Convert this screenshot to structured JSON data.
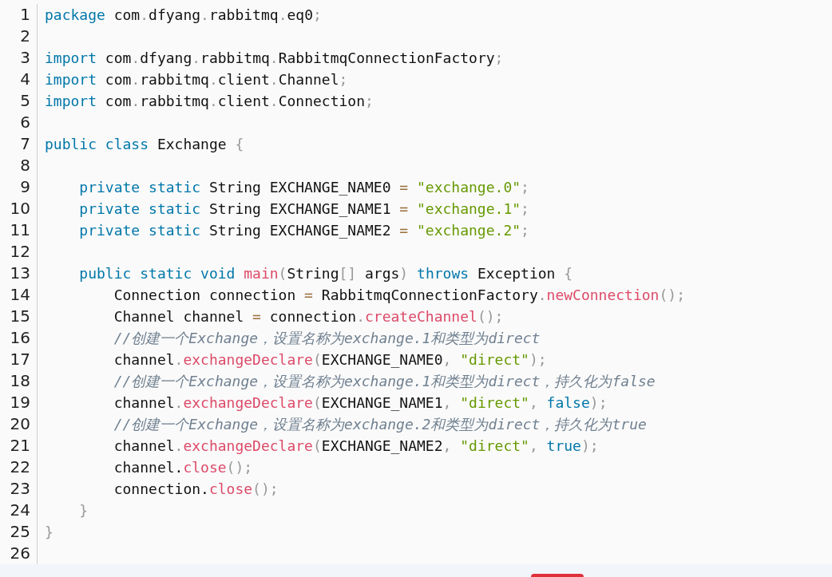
{
  "editor": {
    "lines": [
      {
        "number": "1",
        "tokens": [
          {
            "kind": "keyword",
            "text": "package"
          },
          {
            "kind": "plain",
            "text": " com"
          },
          {
            "kind": "punct",
            "text": "."
          },
          {
            "kind": "plain",
            "text": "dfyang"
          },
          {
            "kind": "punct",
            "text": "."
          },
          {
            "kind": "plain",
            "text": "rabbitmq"
          },
          {
            "kind": "punct",
            "text": "."
          },
          {
            "kind": "plain",
            "text": "eq0"
          },
          {
            "kind": "punct",
            "text": ";"
          }
        ]
      },
      {
        "number": "2"
      },
      {
        "number": "3",
        "tokens": [
          {
            "kind": "keyword",
            "text": "import"
          },
          {
            "kind": "plain",
            "text": " com"
          },
          {
            "kind": "punct",
            "text": "."
          },
          {
            "kind": "plain",
            "text": "dfyang"
          },
          {
            "kind": "punct",
            "text": "."
          },
          {
            "kind": "plain",
            "text": "rabbitmq"
          },
          {
            "kind": "punct",
            "text": "."
          },
          {
            "kind": "plain",
            "text": "RabbitmqConnectionFactory"
          },
          {
            "kind": "punct",
            "text": ";"
          }
        ]
      },
      {
        "number": "4",
        "tokens": [
          {
            "kind": "keyword",
            "text": "import"
          },
          {
            "kind": "plain",
            "text": " com"
          },
          {
            "kind": "punct",
            "text": "."
          },
          {
            "kind": "plain",
            "text": "rabbitmq"
          },
          {
            "kind": "punct",
            "text": "."
          },
          {
            "kind": "plain",
            "text": "client"
          },
          {
            "kind": "punct",
            "text": "."
          },
          {
            "kind": "plain",
            "text": "Channel"
          },
          {
            "kind": "punct",
            "text": ";"
          }
        ]
      },
      {
        "number": "5",
        "tokens": [
          {
            "kind": "keyword",
            "text": "import"
          },
          {
            "kind": "plain",
            "text": " com"
          },
          {
            "kind": "punct",
            "text": "."
          },
          {
            "kind": "plain",
            "text": "rabbitmq"
          },
          {
            "kind": "punct",
            "text": "."
          },
          {
            "kind": "plain",
            "text": "client"
          },
          {
            "kind": "punct",
            "text": "."
          },
          {
            "kind": "plain",
            "text": "Connection"
          },
          {
            "kind": "punct",
            "text": ";"
          }
        ]
      },
      {
        "number": "6"
      },
      {
        "number": "7",
        "tokens": [
          {
            "kind": "keyword",
            "text": "public class"
          },
          {
            "kind": "plain",
            "text": " Exchange "
          },
          {
            "kind": "punct",
            "text": "{"
          }
        ]
      },
      {
        "number": "8"
      },
      {
        "number": "9",
        "tokens": [
          {
            "kind": "keyword",
            "text": "    private static"
          },
          {
            "kind": "plain",
            "text": " String EXCHANGE_NAME0 "
          },
          {
            "kind": "operator",
            "text": "="
          },
          {
            "kind": "string",
            "text": " \"exchange.0\""
          },
          {
            "kind": "punct",
            "text": ";"
          }
        ]
      },
      {
        "number": "10",
        "tokens": [
          {
            "kind": "keyword",
            "text": "    private static"
          },
          {
            "kind": "plain",
            "text": " String EXCHANGE_NAME1 "
          },
          {
            "kind": "operator",
            "text": "="
          },
          {
            "kind": "string",
            "text": " \"exchange.1\""
          },
          {
            "kind": "punct",
            "text": ";"
          }
        ]
      },
      {
        "number": "11",
        "tokens": [
          {
            "kind": "keyword",
            "text": "    private static"
          },
          {
            "kind": "plain",
            "text": " String EXCHANGE_NAME2 "
          },
          {
            "kind": "operator",
            "text": "="
          },
          {
            "kind": "string",
            "text": " \"exchange.2\""
          },
          {
            "kind": "punct",
            "text": ";"
          }
        ]
      },
      {
        "number": "12"
      },
      {
        "number": "13",
        "tokens": [
          {
            "kind": "keyword",
            "text": "    public static void"
          },
          {
            "kind": "function",
            "text": " main"
          },
          {
            "kind": "punct",
            "text": "("
          },
          {
            "kind": "plain",
            "text": "String"
          },
          {
            "kind": "punct",
            "text": "[]"
          },
          {
            "kind": "plain",
            "text": " args"
          },
          {
            "kind": "punct",
            "text": ")"
          },
          {
            "kind": "keyword",
            "text": " throws"
          },
          {
            "kind": "plain",
            "text": " Exception "
          },
          {
            "kind": "punct",
            "text": "{"
          }
        ]
      },
      {
        "number": "14",
        "tokens": [
          {
            "kind": "plain",
            "text": "        Connection connection "
          },
          {
            "kind": "operator",
            "text": "="
          },
          {
            "kind": "plain",
            "text": " RabbitmqConnectionFactory"
          },
          {
            "kind": "punct",
            "text": "."
          },
          {
            "kind": "function",
            "text": "newConnection"
          },
          {
            "kind": "punct",
            "text": "();"
          }
        ]
      },
      {
        "number": "15",
        "tokens": [
          {
            "kind": "plain",
            "text": "        Channel channel "
          },
          {
            "kind": "operator",
            "text": "="
          },
          {
            "kind": "plain",
            "text": " connection"
          },
          {
            "kind": "punct",
            "text": "."
          },
          {
            "kind": "function",
            "text": "createChannel"
          },
          {
            "kind": "punct",
            "text": "();"
          }
        ]
      },
      {
        "number": "16",
        "tokens": [
          {
            "kind": "comment",
            "text": "        //创建一个Exchange，设置名称为exchange.1和类型为direct"
          }
        ]
      },
      {
        "number": "17",
        "tokens": [
          {
            "kind": "plain",
            "text": "        channel"
          },
          {
            "kind": "punct",
            "text": "."
          },
          {
            "kind": "function",
            "text": "exchangeDeclare"
          },
          {
            "kind": "punct",
            "text": "("
          },
          {
            "kind": "plain",
            "text": "EXCHANGE_NAME0"
          },
          {
            "kind": "punct",
            "text": ","
          },
          {
            "kind": "string",
            "text": " \"direct\""
          },
          {
            "kind": "punct",
            "text": ");"
          }
        ]
      },
      {
        "number": "18",
        "tokens": [
          {
            "kind": "comment",
            "text": "        //创建一个Exchange，设置名称为exchange.1和类型为direct，持久化为false"
          }
        ]
      },
      {
        "number": "19",
        "tokens": [
          {
            "kind": "plain",
            "text": "        channel"
          },
          {
            "kind": "punct",
            "text": "."
          },
          {
            "kind": "function",
            "text": "exchangeDeclare"
          },
          {
            "kind": "punct",
            "text": "("
          },
          {
            "kind": "plain",
            "text": "EXCHANGE_NAME1"
          },
          {
            "kind": "punct",
            "text": ","
          },
          {
            "kind": "string",
            "text": " \"direct\""
          },
          {
            "kind": "punct",
            "text": ","
          },
          {
            "kind": "keyword",
            "text": " false"
          },
          {
            "kind": "punct",
            "text": ");"
          }
        ]
      },
      {
        "number": "20",
        "tokens": [
          {
            "kind": "comment",
            "text": "        //创建一个Exchange，设置名称为exchange.2和类型为direct，持久化为true"
          }
        ]
      },
      {
        "number": "21",
        "tokens": [
          {
            "kind": "plain",
            "text": "        channel"
          },
          {
            "kind": "punct",
            "text": "."
          },
          {
            "kind": "function",
            "text": "exchangeDeclare"
          },
          {
            "kind": "punct",
            "text": "("
          },
          {
            "kind": "plain",
            "text": "EXCHANGE_NAME2"
          },
          {
            "kind": "punct",
            "text": ","
          },
          {
            "kind": "string",
            "text": " \"direct\""
          },
          {
            "kind": "punct",
            "text": ","
          },
          {
            "kind": "keyword",
            "text": " true"
          },
          {
            "kind": "punct",
            "text": ");"
          }
        ]
      },
      {
        "number": "22",
        "tokens": [
          {
            "kind": "plain",
            "text": "        channel."
          },
          {
            "kind": "function",
            "text": "close"
          },
          {
            "kind": "punct",
            "text": "();"
          }
        ]
      },
      {
        "number": "23",
        "tokens": [
          {
            "kind": "plain",
            "text": "        connection."
          },
          {
            "kind": "function",
            "text": "close"
          },
          {
            "kind": "punct",
            "text": "();"
          }
        ]
      },
      {
        "number": "24",
        "tokens": [
          {
            "kind": "punct",
            "text": "    }"
          }
        ]
      },
      {
        "number": "25",
        "tokens": [
          {
            "kind": "punct",
            "text": "}"
          }
        ]
      },
      {
        "number": "26"
      }
    ]
  }
}
